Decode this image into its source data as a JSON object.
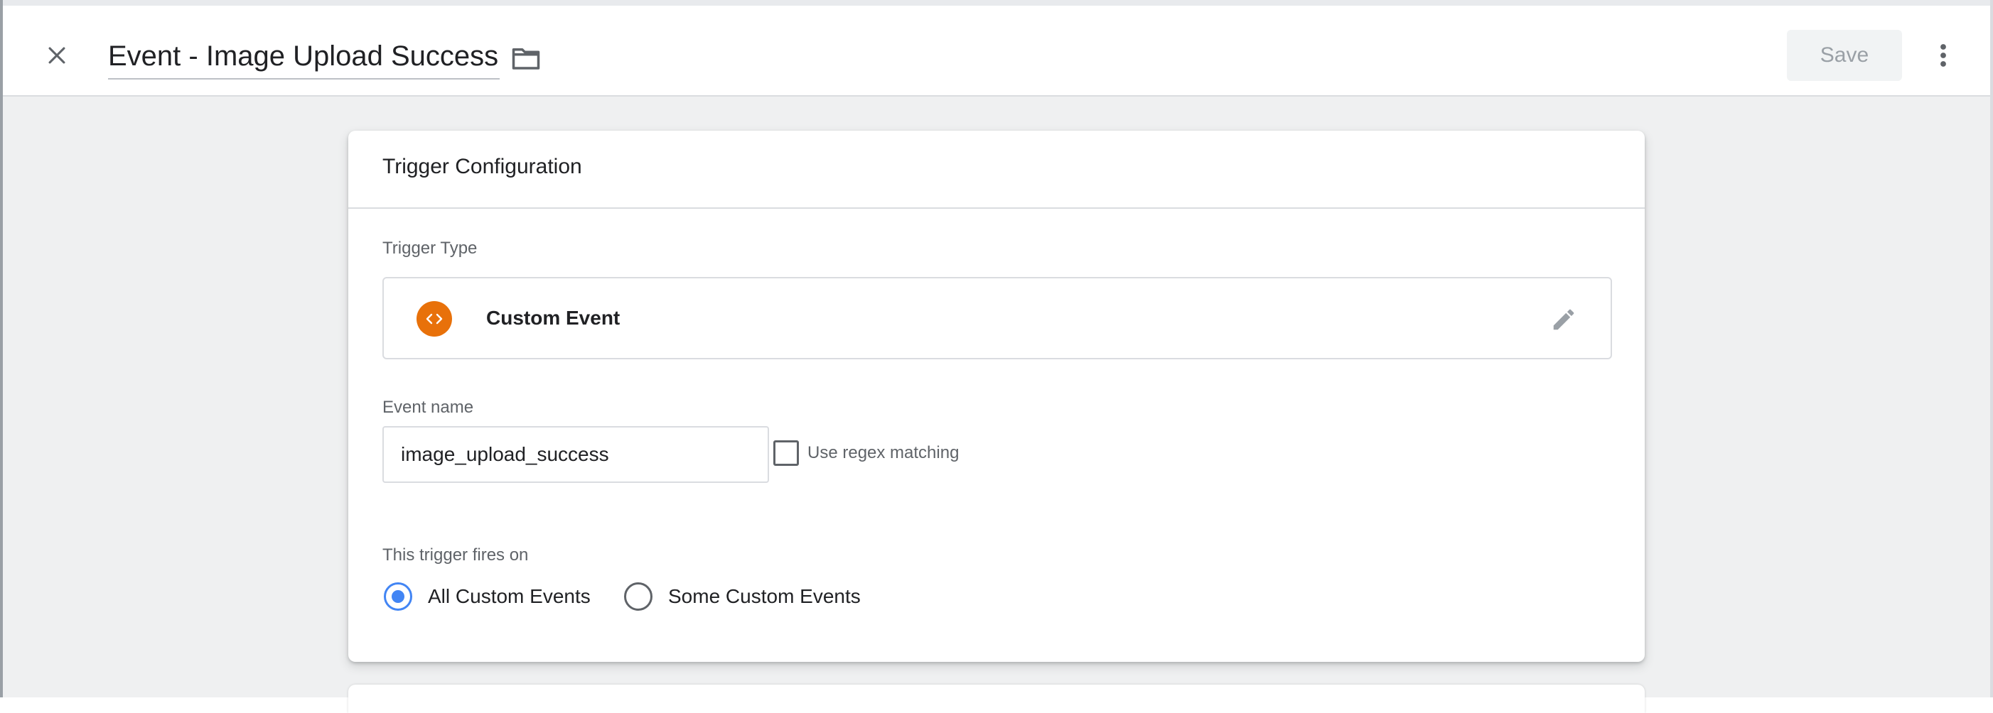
{
  "header": {
    "title": "Event - Image Upload Success",
    "save_label": "Save"
  },
  "card": {
    "title": "Trigger Configuration",
    "trigger_type_label": "Trigger Type",
    "trigger_type_name": "Custom Event",
    "trigger_type_icon": "code-brackets-icon",
    "trigger_type_icon_color": "#e8710a",
    "event_name_label": "Event name",
    "event_name_value": "image_upload_success",
    "regex_label": "Use regex matching",
    "regex_checked": false,
    "fires_on_label": "This trigger fires on",
    "fires_on_options": [
      {
        "label": "All Custom Events",
        "selected": true
      },
      {
        "label": "Some Custom Events",
        "selected": false
      }
    ]
  },
  "colors": {
    "accent": "#4285f4",
    "canvas": "#eff0f1",
    "save_disabled_bg": "#f1f3f4"
  }
}
